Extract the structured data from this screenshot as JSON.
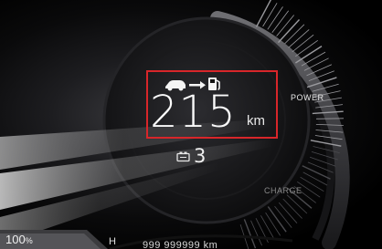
{
  "cluster": {
    "range_value": "215",
    "range_unit": "km",
    "range_icon": "car-to-fuel-pump-icon",
    "battery_icon": "battery-icon",
    "gear_value": "3",
    "power_label": "POWER",
    "charge_label": "CHARGE",
    "battery_percent_value": "100",
    "battery_percent_unit": "%",
    "h_marker": "H",
    "odometer_text": "999 999999 km",
    "highlight_color": "#d8262a"
  }
}
